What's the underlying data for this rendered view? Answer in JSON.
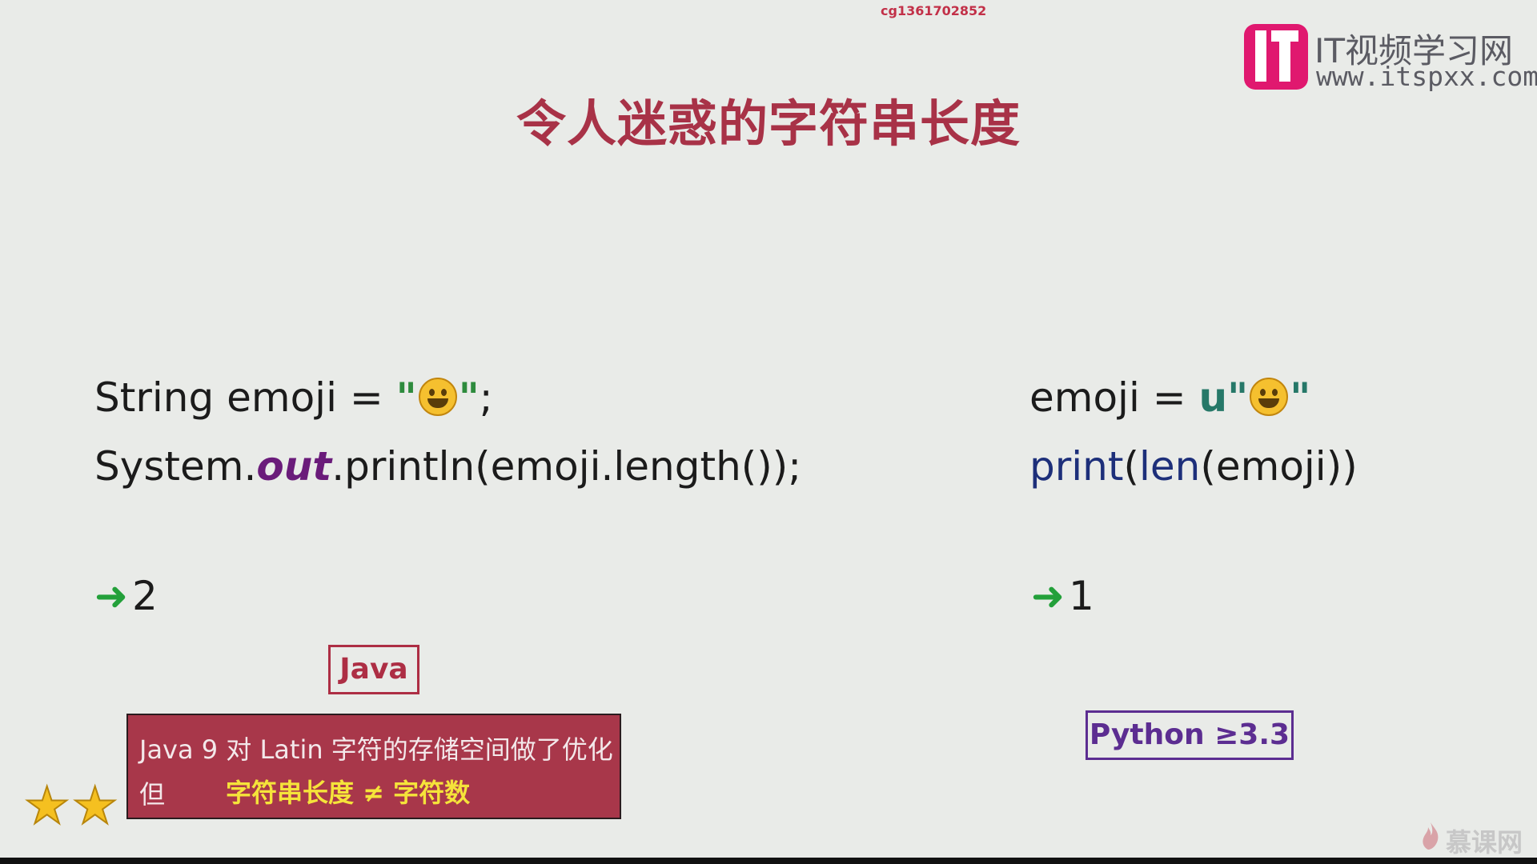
{
  "header": {
    "user_id": "cg1361702852",
    "title": "令人迷惑的字符串长度"
  },
  "logo": {
    "name": "IT视频学习网",
    "url": "www.itspxx.com",
    "brand_color": "#e0186f"
  },
  "java": {
    "line1_pre": "String emoji = ",
    "quote_open": "\"",
    "emoji_icon": "grinning-face-icon",
    "quote_close": "\"",
    "line1_post": ";",
    "line2_a": "System.",
    "line2_out": "out",
    "line2_b": ".println(emoji.length());",
    "result": "2",
    "tag": "Java"
  },
  "python": {
    "line1_pre": "emoji = ",
    "u_prefix": "u\"",
    "quote_close": "\"",
    "print": "print",
    "paren1": "(",
    "len": "len",
    "rest": "(emoji))",
    "result": "1",
    "tag": "Python ≥3.3"
  },
  "note": {
    "line1": "Java 9 对 Latin 字符的存储空间做了优化",
    "line2_lead": "但",
    "line2": "字符串长度 ≠ 字符数"
  },
  "rating": {
    "stars": 2
  },
  "footer": {
    "watermark": "慕课网"
  },
  "colors": {
    "title": "#a83247",
    "arrow": "#23a03a",
    "note_bg": "#a8374a",
    "note_highlight": "#f5e33a"
  }
}
